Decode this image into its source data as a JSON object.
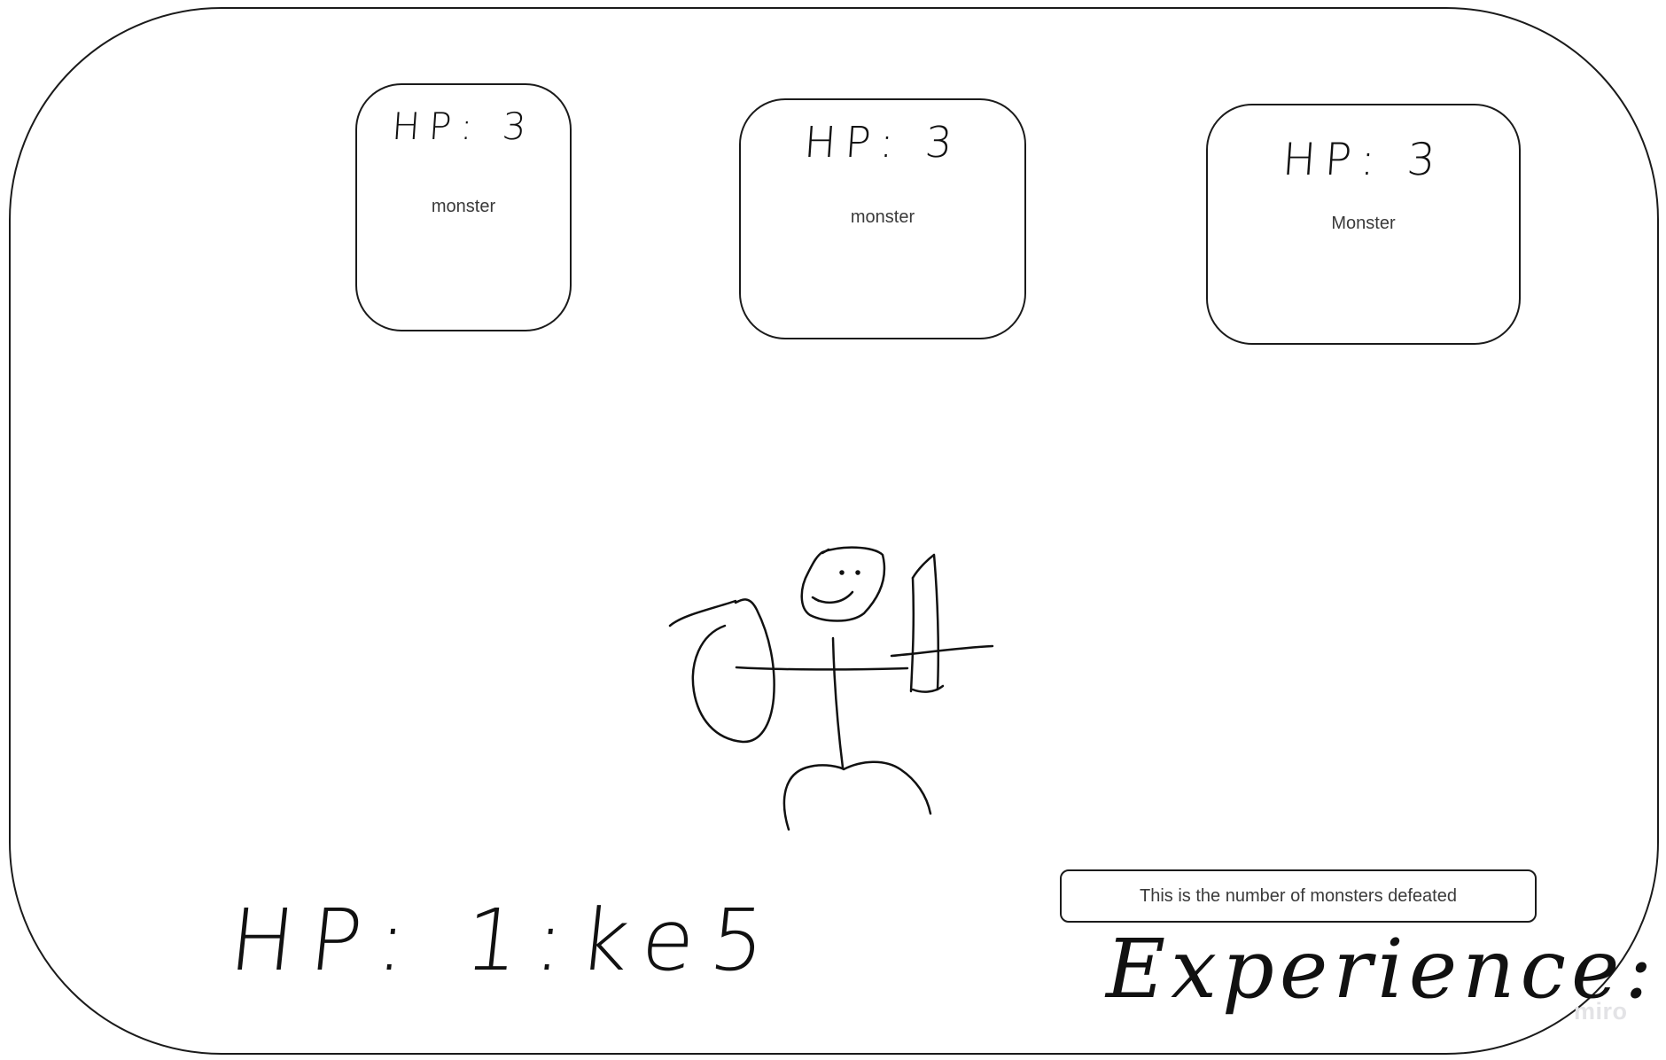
{
  "monsters": [
    {
      "hp_label": "HP: 3",
      "name": "monster"
    },
    {
      "hp_label": "HP: 3",
      "name": "monster"
    },
    {
      "hp_label": "HP: 3",
      "name": "Monster"
    }
  ],
  "player": {
    "hp_label": "HP: 1:ke5"
  },
  "defeated_counter": {
    "text": "This is the number of monsters defeated"
  },
  "experience": {
    "label": "Experience:"
  },
  "watermark": "miro",
  "colors": {
    "stroke": "#1b1b1b",
    "text": "#3a3a3a",
    "background": "#ffffff",
    "watermark": "#e3e3e6"
  }
}
